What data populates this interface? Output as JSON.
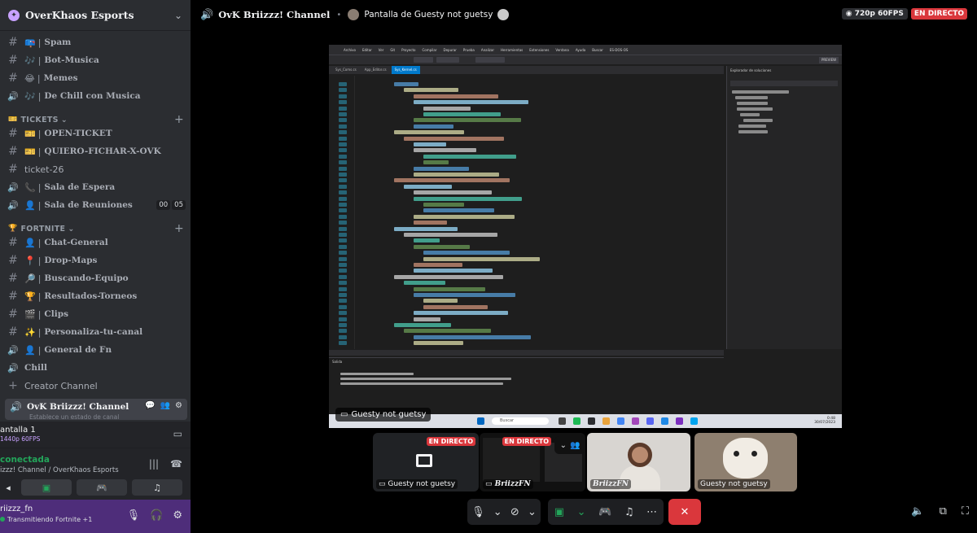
{
  "server": {
    "name": "OverKhaos Esports"
  },
  "channels_top": [
    {
      "emoji": "📪",
      "label": "Spam",
      "type": "text"
    },
    {
      "emoji": "🎶",
      "label": "Bot-Musica",
      "type": "text"
    },
    {
      "emoji": "😂",
      "label": "Memes",
      "type": "text"
    },
    {
      "emoji": "🎶",
      "label": "De Chill con Musica",
      "type": "voice"
    }
  ],
  "categories": {
    "tickets": {
      "emoji": "🎫",
      "label": "TICKETS"
    },
    "fortnite": {
      "emoji": "🏆",
      "label": "FORTNITE"
    }
  },
  "channels_tickets": [
    {
      "emoji": "🎫",
      "label": "OPEN-TICKET",
      "type": "text"
    },
    {
      "emoji": "🎫",
      "label": "QUIERO-FICHAR-X-OVK",
      "type": "text"
    },
    {
      "emoji": "",
      "label": "ticket-26",
      "type": "text",
      "plain": true
    },
    {
      "emoji": "📞",
      "label": "Sala de Espera",
      "type": "voice"
    },
    {
      "emoji": "👤",
      "label": "Sala de Reuniones",
      "type": "voice",
      "badges": [
        "00",
        "05"
      ]
    }
  ],
  "channels_fortnite": [
    {
      "emoji": "👤",
      "label": "Chat-General",
      "type": "text"
    },
    {
      "emoji": "📍",
      "label": "Drop-Maps",
      "type": "text"
    },
    {
      "emoji": "🔎",
      "label": "Buscando-Equipo",
      "type": "text"
    },
    {
      "emoji": "🏆",
      "label": "Resultados-Torneos",
      "type": "text"
    },
    {
      "emoji": "🎬",
      "label": "Clips",
      "type": "text"
    },
    {
      "emoji": "✨",
      "label": "Personaliza-tu-canal",
      "type": "text"
    },
    {
      "emoji": "👤",
      "label": "General de Fn",
      "type": "voice"
    },
    {
      "emoji": "",
      "label": "Chill",
      "type": "voice"
    },
    {
      "emoji": "",
      "label": "Creator Channel",
      "type": "add",
      "plain": true
    }
  ],
  "active_channel": {
    "name": "OvK Briizzz! Channel",
    "status": "Establece un estado de canal"
  },
  "stream_panel": {
    "title": "antalla 1",
    "quality": "1440p 60FPS"
  },
  "voice": {
    "connected": "conectada",
    "location": "izzz! Channel / OverKhaos Esports"
  },
  "user": {
    "name": "riizzz_fn",
    "status": "Transmitiendo Fortnite +1"
  },
  "topbar": {
    "channel": "OvK Briizzz! Channel",
    "screen_title": "Pantalla de Guesty not guetsy",
    "quality": "720p 60FPS",
    "live": "EN DIRECTO"
  },
  "main_stream": {
    "label": "Guesty not guetsy"
  },
  "stream_content": {
    "menu": [
      "Archivo",
      "Editar",
      "Ver",
      "Git",
      "Proyecto",
      "Compilar",
      "Depurar",
      "Prueba",
      "Analizar",
      "Herramientas",
      "Extensiones",
      "Ventana",
      "Ayuda",
      "Buscar",
      "ES-DOS-OS"
    ],
    "tabs": [
      "Sys_Coms.cs",
      "App_Editor.cs",
      "Sys_Kernel.cs"
    ],
    "explorer_title": "Explorador de soluciones",
    "output_title": "Salida",
    "preview": "PREVIEW",
    "taskbar_search": "Buscar",
    "clock_time": "0:48",
    "clock_date": "30/07/2023"
  },
  "thumbnails": [
    {
      "label": "Guesty not guetsy",
      "live": "EN DIRECTO"
    },
    {
      "label": "BriizzFN",
      "live": "EN DIRECTO"
    },
    {
      "label": "BriizzFN"
    },
    {
      "label": "Guesty not guetsy"
    }
  ],
  "colors": {
    "accent": "#23a55a",
    "live": "#da373c",
    "sidebar": "#2b2d31",
    "user_panel": "#4e2d7a"
  }
}
